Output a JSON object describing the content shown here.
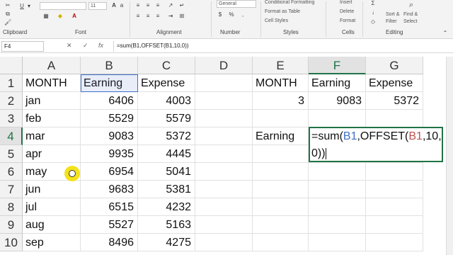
{
  "ribbon": {
    "font_name": "",
    "font_size": "11",
    "number_format": "General",
    "conditional_formatting": "Conditional Formatting",
    "format_as_table": "Format as Table",
    "cell_styles": "Cell Styles",
    "insert": "Insert",
    "delete": "Delete",
    "format": "Format",
    "sort_filter": "Sort &",
    "filter": "Filter",
    "find_select": "Find &",
    "select": "Select",
    "groups": [
      "Clipboard",
      "Font",
      "Alignment",
      "Number",
      "Styles",
      "Cells",
      "Editing"
    ]
  },
  "formula_bar": {
    "name_box": "F4",
    "cancel_icon": "✕",
    "enter_icon": "✓",
    "fx_label": "fx",
    "formula": "=sum(B1,OFFSET(B1,10,0))"
  },
  "columns": [
    "A",
    "B",
    "C",
    "D",
    "E",
    "F",
    "G"
  ],
  "rows": [
    "1",
    "2",
    "3",
    "4",
    "5",
    "6",
    "7",
    "8",
    "9",
    "10"
  ],
  "table": {
    "A": [
      "MONTH",
      "jan",
      "feb",
      "mar",
      "apr",
      "may",
      "jun",
      "jul",
      "aug",
      "sep"
    ],
    "B": [
      "Earning",
      "6406",
      "5529",
      "9083",
      "9935",
      "6954",
      "9683",
      "6515",
      "5527",
      "8496"
    ],
    "C": [
      "Expense",
      "4003",
      "5579",
      "5372",
      "4445",
      "5041",
      "5381",
      "4232",
      "5163",
      "4275"
    ]
  },
  "side": {
    "E1": "MONTH",
    "F1": "Earning",
    "G1": "Expense",
    "E2": "3",
    "F2": "9083",
    "G2": "5372",
    "E4": "Earning"
  },
  "editor": {
    "p1": "=sum(",
    "r1": "B1",
    "p2": ",OFFSET(",
    "r2": "B1",
    "p3": ",10,",
    "line2": "0))"
  }
}
